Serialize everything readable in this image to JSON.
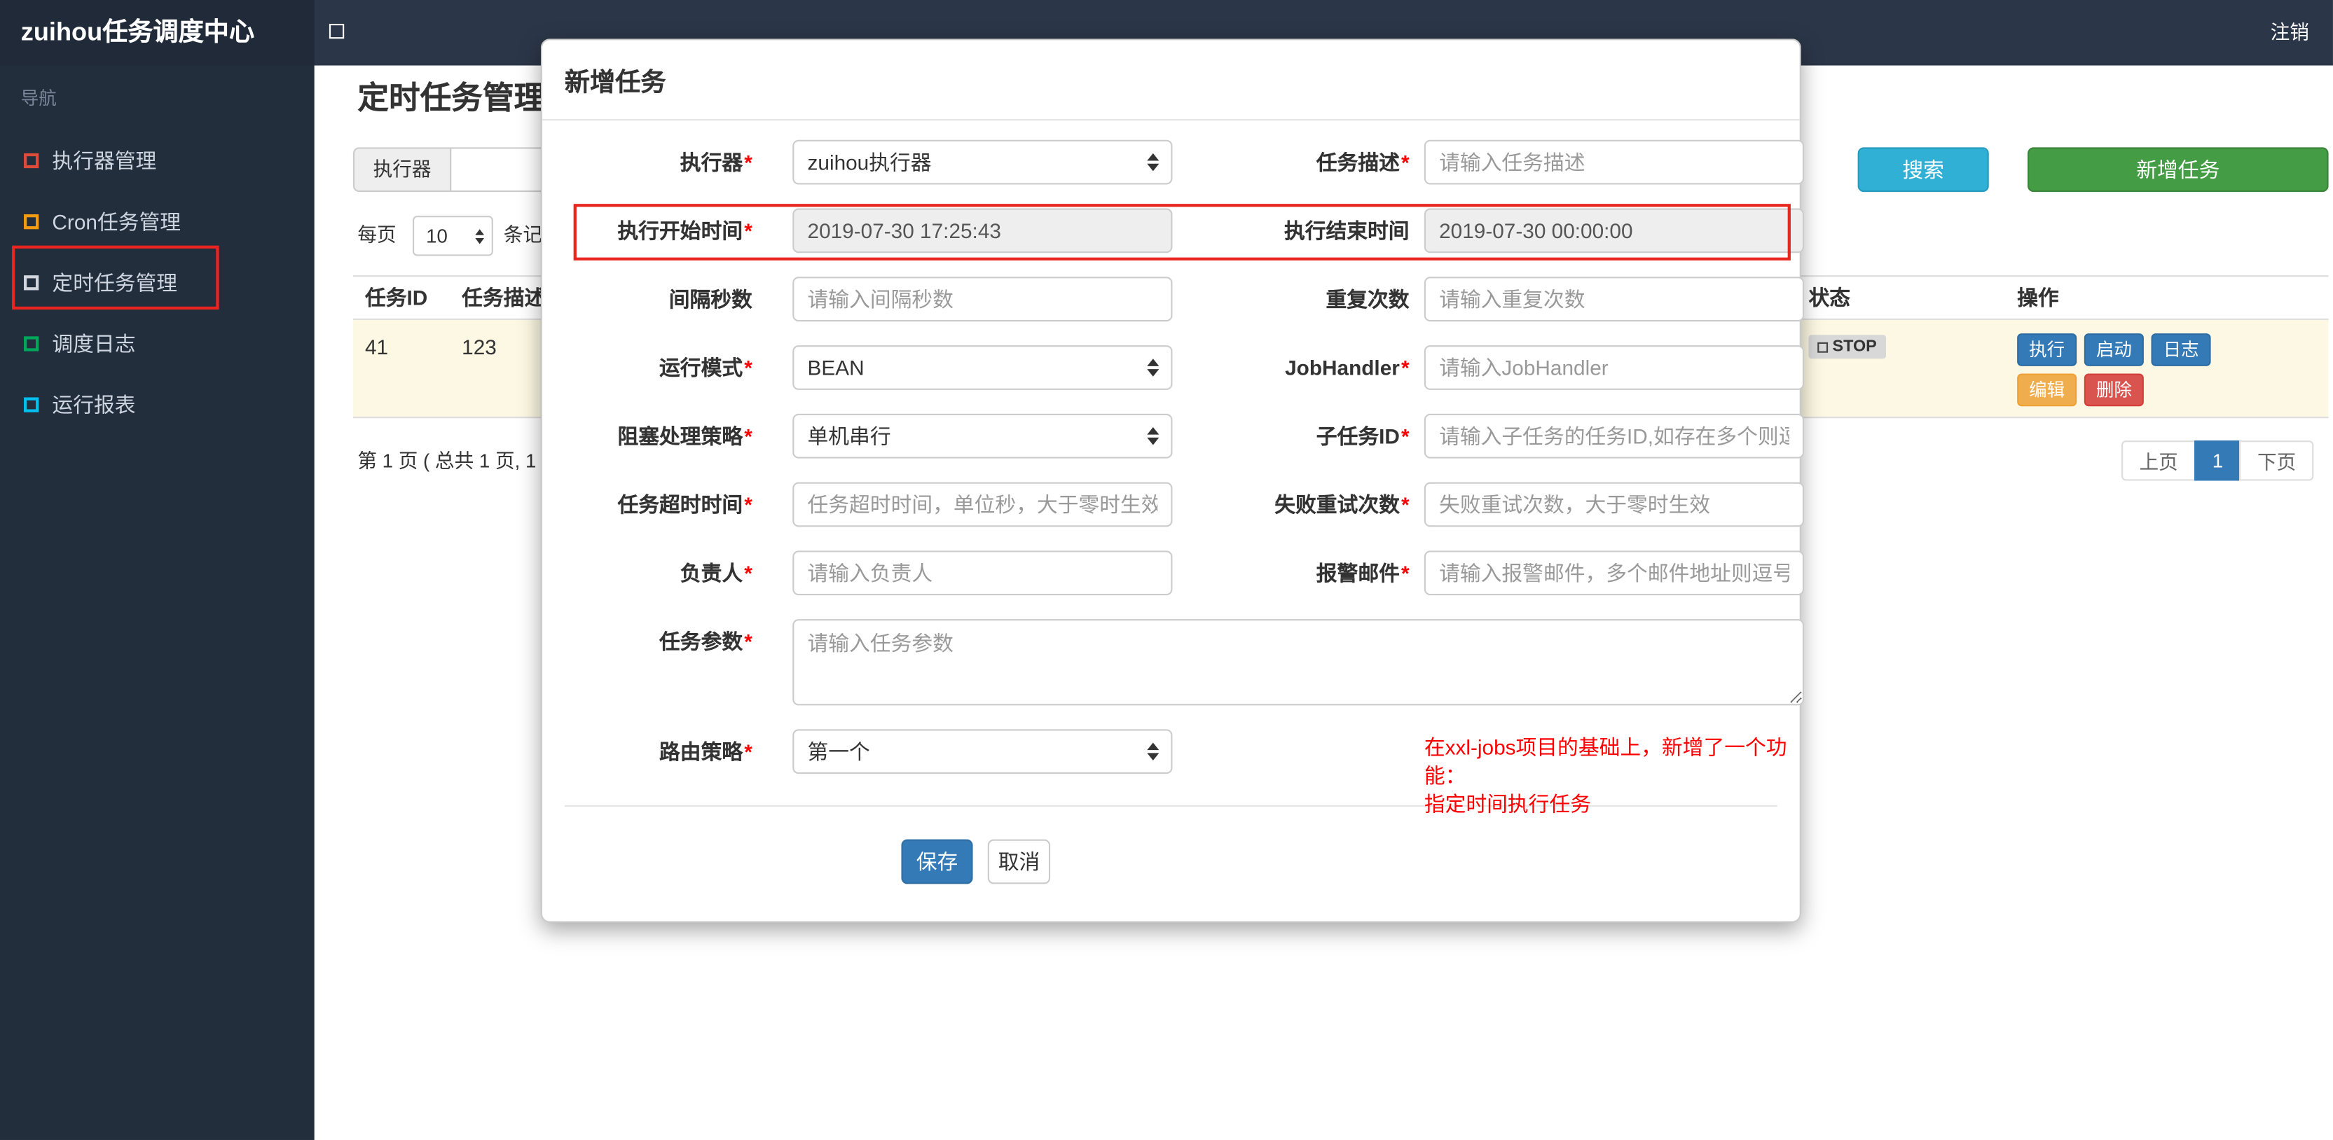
{
  "colors": {
    "navbar_bg": "#2b3648",
    "sidebar_bg": "#222e3c",
    "accent_blue": "#337ab7",
    "info_teal": "#31b0d5",
    "success_green": "#449d44",
    "warning_orange": "#f0ad4e",
    "danger_red": "#d9534f",
    "annotation_red": "#e8251f",
    "icon_red": "#dd4b39",
    "icon_orange": "#f39c12",
    "icon_gray": "#d2d6de",
    "icon_green": "#00a65a",
    "icon_cyan": "#00c0ef"
  },
  "navbar": {
    "brand": "zuihou任务调度中心",
    "logout": "注销"
  },
  "sidebar": {
    "header": "导航",
    "items": [
      {
        "label": "执行器管理"
      },
      {
        "label": "Cron任务管理"
      },
      {
        "label": "定时任务管理"
      },
      {
        "label": "调度日志"
      },
      {
        "label": "运行报表"
      }
    ]
  },
  "page": {
    "title": "定时任务管理",
    "filter_addon": "执行器",
    "search_button": "搜索",
    "add_button": "新增任务",
    "per_page_label": "每页",
    "per_page_value": "10",
    "per_page_suffix": "条记",
    "table": {
      "headers": [
        "任务ID",
        "任务描述",
        "状态",
        "操作"
      ],
      "row": {
        "job_id": "41",
        "job_desc": "123",
        "status": "STOP",
        "actions": {
          "run": "执行",
          "start": "启动",
          "log": "日志",
          "edit": "编辑",
          "delete": "删除"
        }
      }
    },
    "pagination": {
      "summary": "第 1 页 ( 总共 1 页, 1",
      "prev": "上页",
      "current": "1",
      "next": "下页"
    }
  },
  "modal": {
    "title": "新增任务",
    "required_mark": "*",
    "form": {
      "executor": {
        "label": "执行器",
        "value": "zuihou执行器"
      },
      "job_desc": {
        "label": "任务描述",
        "placeholder": "请输入任务描述"
      },
      "start_time": {
        "label": "执行开始时间",
        "value": "2019-07-30 17:25:43"
      },
      "end_time": {
        "label": "执行结束时间",
        "value": "2019-07-30 00:00:00"
      },
      "interval": {
        "label": "间隔秒数",
        "placeholder": "请输入间隔秒数"
      },
      "repeat_count": {
        "label": "重复次数",
        "placeholder": "请输入重复次数"
      },
      "run_mode": {
        "label": "运行模式",
        "value": "BEAN"
      },
      "job_handler": {
        "label": "JobHandler",
        "placeholder": "请输入JobHandler"
      },
      "block_strategy": {
        "label": "阻塞处理策略",
        "value": "单机串行"
      },
      "child_job_id": {
        "label": "子任务ID",
        "placeholder": "请输入子任务的任务ID,如存在多个则逗号分隔"
      },
      "timeout": {
        "label": "任务超时时间",
        "placeholder": "任务超时时间，单位秒，大于零时生效"
      },
      "fail_retry": {
        "label": "失败重试次数",
        "placeholder": "失败重试次数，大于零时生效"
      },
      "owner": {
        "label": "负责人",
        "placeholder": "请输入负责人"
      },
      "alarm_email": {
        "label": "报警邮件",
        "placeholder": "请输入报警邮件，多个邮件地址则逗号分隔"
      },
      "job_param": {
        "label": "任务参数",
        "placeholder": "请输入任务参数"
      },
      "route_strategy": {
        "label": "路由策略",
        "value": "第一个"
      }
    },
    "note_line1": "在xxl-jobs项目的基础上，新增了一个功能：",
    "note_line2": "指定时间执行任务",
    "save_button": "保存",
    "cancel_button": "取消"
  }
}
